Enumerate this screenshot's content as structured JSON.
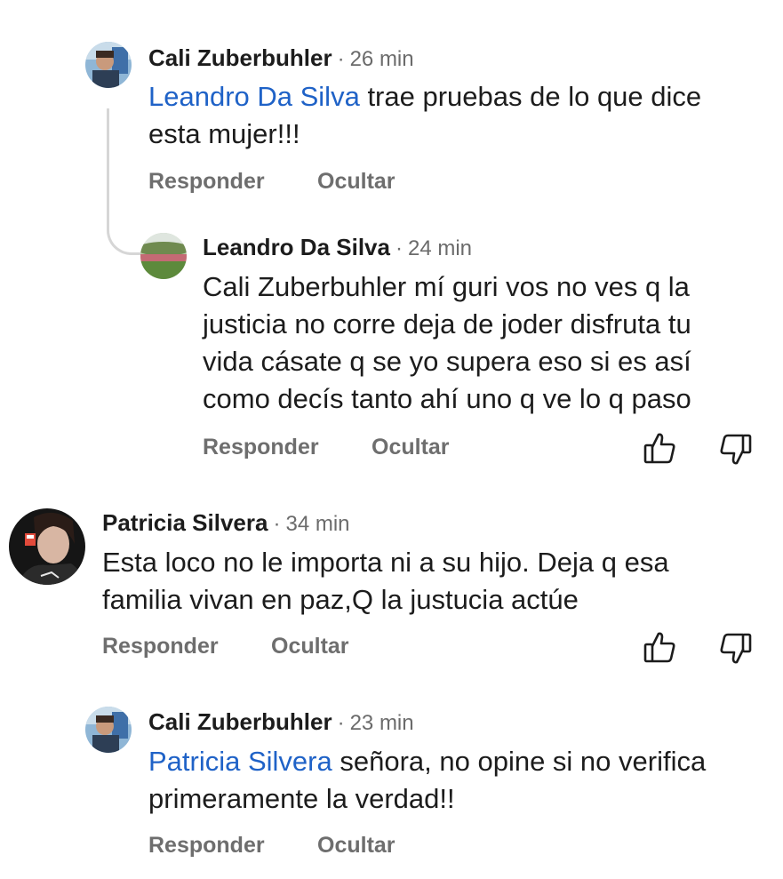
{
  "comments": [
    {
      "author": "Cali Zuberbuhler",
      "time": "26 min",
      "mention": "Leandro Da Silva",
      "text_line1": " trae pruebas de lo que dice",
      "text_line2": "esta mujer!!!",
      "reply_label": "Responder",
      "hide_label": "Ocultar"
    },
    {
      "author": "Leandro Da Silva",
      "time": "24 min",
      "lines": [
        "Cali Zuberbuhler mí guri vos no ves q la",
        "justicia no corre deja de joder disfruta tu",
        "vida cásate q se yo supera eso si es así",
        "como decís tanto ahí uno q ve lo q paso"
      ],
      "reply_label": "Responder",
      "hide_label": "Ocultar"
    },
    {
      "author": "Patricia Silvera",
      "time": "34 min",
      "lines": [
        "Esta loco no le importa ni a su hijo. Deja q esa",
        "familia vivan en paz,Q la justucia actúe"
      ],
      "reply_label": "Responder",
      "hide_label": "Ocultar"
    },
    {
      "author": "Cali Zuberbuhler",
      "time": "23 min",
      "mention": "Patricia Silvera",
      "text_line1": " señora, no opine si no verifica",
      "text_line2": "primeramente la verdad!!",
      "reply_label": "Responder",
      "hide_label": "Ocultar"
    }
  ],
  "separator": "·",
  "icons": {
    "like": "thumbs-up-icon",
    "dislike": "thumbs-down-icon"
  },
  "colors": {
    "mention": "#1f62c7",
    "action": "#6e6e6e",
    "text": "#1c1c1c"
  }
}
